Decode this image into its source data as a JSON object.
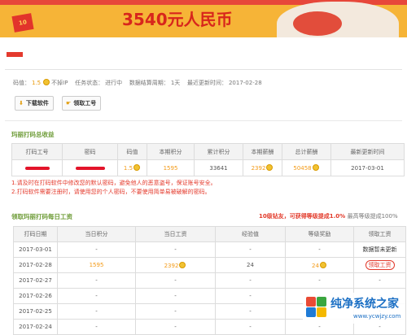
{
  "banner": {
    "headline": "3540元人民币",
    "envelope_text": "10"
  },
  "meta": {
    "rate_label": "码值：",
    "rate_value": "1.5",
    "no_ip": "不掉IP",
    "status_label": "任务状态：",
    "status_value": "进行中",
    "period_label": "数据结算周期：",
    "period_value": "1天",
    "updated_label": "最近更新时间：",
    "updated_value": "2017-02-28"
  },
  "buttons": {
    "download": "下载软件",
    "claim_account": "领取工号"
  },
  "summary": {
    "title": "玛丽打码总收益",
    "headers": [
      "打码工号",
      "密码",
      "码值",
      "本期积分",
      "累计积分",
      "本期薪酬",
      "总计薪酬",
      "最新更新时间"
    ],
    "row": {
      "rate": "1.5",
      "points": "1595",
      "total_points": "33641",
      "pay": "2392",
      "total_pay": "50458",
      "updated": "2017-03-01"
    }
  },
  "notes": [
    "1.请及时在打码软件中修改您的默认密码，避免他人的恶意盗号，保证账号安全。",
    "2.打码软件需要注册时，请使用您的个人密码，不要使用简单易被破解的密码。"
  ],
  "daily": {
    "title": "领取玛丽打码每日工资",
    "annotation_main": "10级钻友，可获得等级提成1.0%",
    "annotation_tail": "最高等级提成100%",
    "headers": [
      "打码日期",
      "当日积分",
      "当日工资",
      "经验值",
      "等级奖励",
      "领取工资"
    ],
    "rows": [
      {
        "date": "2017-03-01",
        "points": "-",
        "wage": "-",
        "exp": "-",
        "bonus": "-",
        "action": "数据暂未更新"
      },
      {
        "date": "2017-02-28",
        "points": "1595",
        "wage": "2392",
        "exp": "24",
        "bonus": "24",
        "action": "领取工资"
      },
      {
        "date": "2017-02-27",
        "points": "-",
        "wage": "-",
        "exp": "-",
        "bonus": "-",
        "action": "-"
      },
      {
        "date": "2017-02-26",
        "points": "-",
        "wage": "-",
        "exp": "-",
        "bonus": "-",
        "action": "-"
      },
      {
        "date": "2017-02-25",
        "points": "-",
        "wage": "-",
        "exp": "-",
        "bonus": "-",
        "action": "-"
      },
      {
        "date": "2017-02-24",
        "points": "-",
        "wage": "-",
        "exp": "-",
        "bonus": "-",
        "action": "-"
      }
    ]
  },
  "watermark": {
    "title": "纯净系统之家",
    "url": "www.ycwjzy.com"
  },
  "colors": {
    "accent_red": "#e43a2e",
    "section_green": "#6e9c38",
    "gold": "#f39a16"
  }
}
